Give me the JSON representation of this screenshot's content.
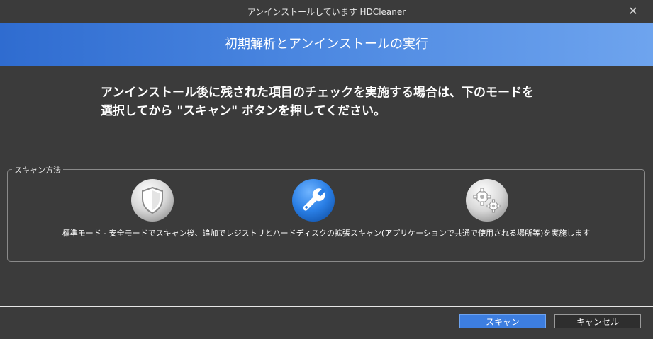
{
  "window": {
    "title": "アンインストールしています HDCleaner",
    "minimize_glyph": "",
    "close_glyph": "✕"
  },
  "header": {
    "title": "初期解析とアンインストールの実行"
  },
  "instruction": {
    "line1": "アンインストール後に残された項目のチェックを実施する場合は、下のモードを",
    "line2": "選択してから \"スキャン\" ボタンを押してください。"
  },
  "scan_method": {
    "legend": "スキャン方法",
    "modes": [
      {
        "name": "standard",
        "icon": "shield-icon"
      },
      {
        "name": "advanced",
        "icon": "wrench-icon",
        "selected": true
      },
      {
        "name": "custom",
        "icon": "gears-icon"
      }
    ],
    "description": "標準モード - 安全モードでスキャン後、追加でレジストリとハードディスクの拡張スキャン(アプリケーションで共通で使用される場所等)を実施します"
  },
  "footer": {
    "scan_label": "スキャン",
    "cancel_label": "キャンセル"
  },
  "colors": {
    "background": "#3b3b3b",
    "header_start": "#2f6cd0",
    "header_end": "#6ea4ee",
    "accent": "#3d7ee0"
  }
}
